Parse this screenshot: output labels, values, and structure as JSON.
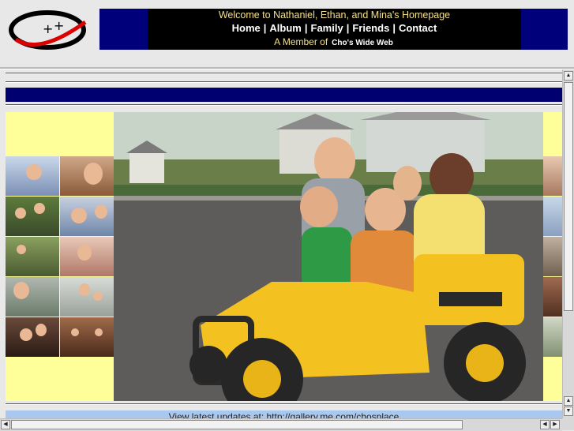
{
  "header": {
    "welcome": "Welcome to Nathaniel, Ethan, and Mina's Homepage",
    "nav": [
      {
        "label": "Home"
      },
      {
        "label": "Album"
      },
      {
        "label": "Family"
      },
      {
        "label": "Friends"
      },
      {
        "label": "Contact"
      }
    ],
    "member_prefix": "A Member of",
    "member_site": "Cho's Wide Web"
  },
  "main": {
    "update_text": "View latest updates at:  http://gallery.me.com/chosplace"
  },
  "colors": {
    "banner_blue": "#00007a",
    "banner_black": "#000000",
    "accent_yellow": "#ffff99",
    "update_bar": "#a8c8f0"
  },
  "icons": {
    "logo": "ccw-logo-icon",
    "scroll_up": "arrow-up-icon",
    "scroll_down": "arrow-down-icon",
    "scroll_left": "arrow-left-icon",
    "scroll_right": "arrow-right-icon"
  }
}
